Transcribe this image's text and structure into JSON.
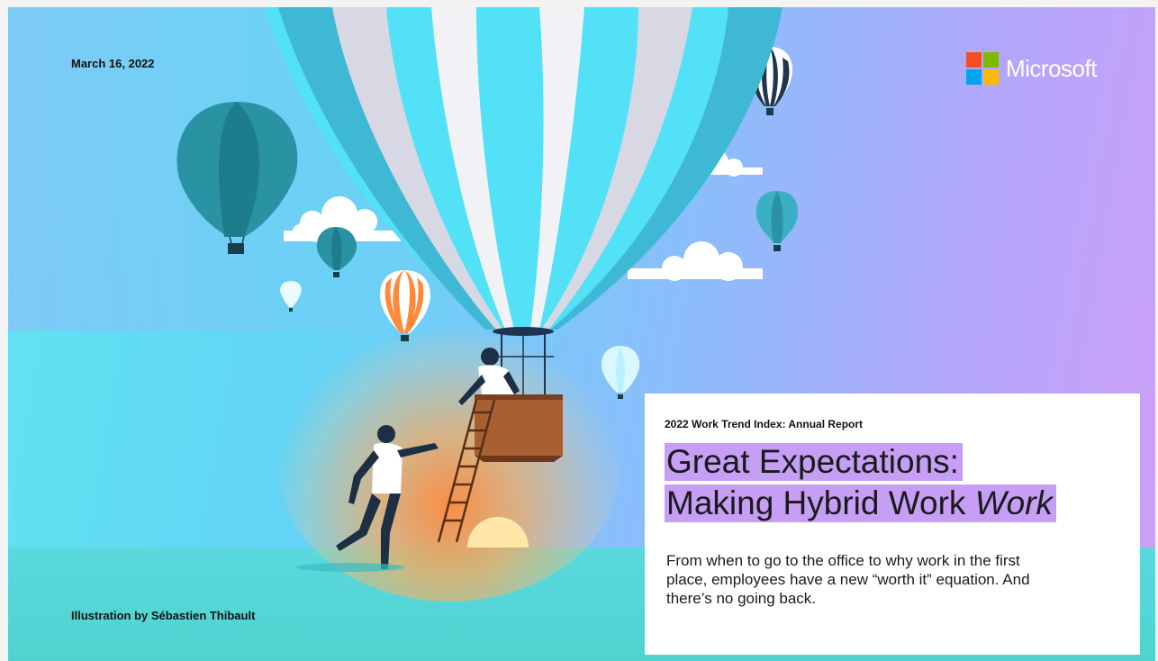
{
  "date": "March 16, 2022",
  "brand": {
    "name": "Microsoft",
    "logo_colors": [
      "#f25022",
      "#7fba00",
      "#00a4ef",
      "#ffb900"
    ]
  },
  "report": {
    "kicker": "2022 Work Trend Index: Annual Report",
    "headline_line1": "Great Expectations:",
    "headline_line2_prefix": "Making Hybrid Work ",
    "headline_line2_emphasis": "Work",
    "description": "From when to go to the office to why work in the first place, employees have a new “worth it” equation. And there’s no going back."
  },
  "illustration_credit": "Illustration by Sébastien Thibault",
  "colors": {
    "highlight": "#c79ef5",
    "balloon_cyan": "#52e1f6",
    "balloon_teal": "#238a9c",
    "glow_orange": "#ff8a3c"
  }
}
